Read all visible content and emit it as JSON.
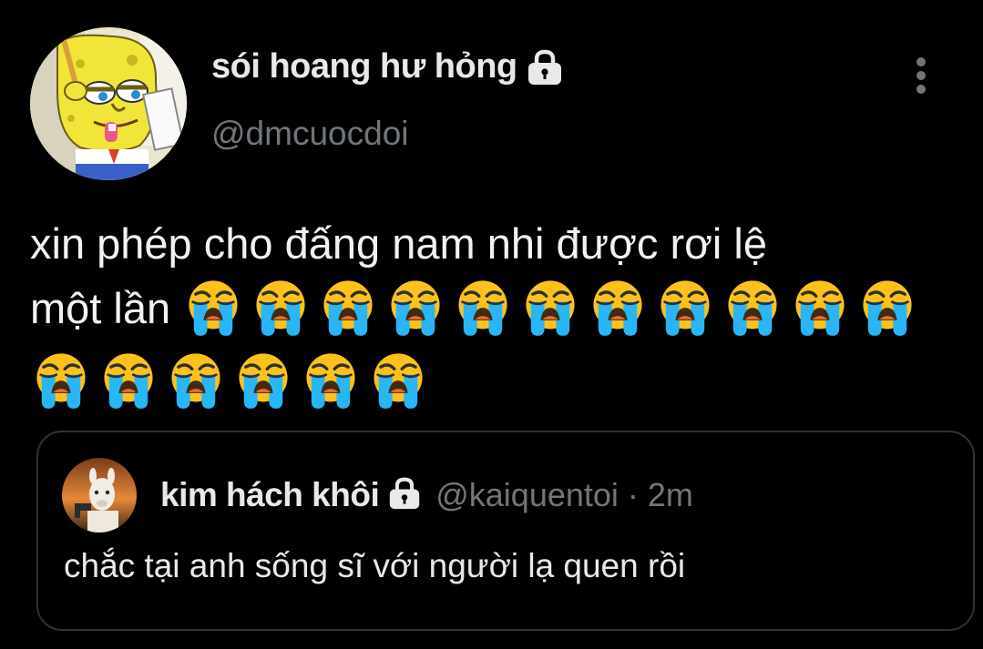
{
  "tweet": {
    "author": {
      "display_name": "sói hoang hư hỏng",
      "handle": "@dmcuocdoi",
      "avatar_icon": "spongebob-avatar",
      "protected_icon": "lock-icon"
    },
    "text": "xin phép cho đấng nam nhi được rơi lệ một lần",
    "text_line1": "xin phép cho đấng nam nhi được rơi lệ",
    "text_line2": "một lần",
    "emoji": "loudly-crying-face",
    "emoji_char": "😭",
    "emoji_count": 17,
    "more_icon": "more-vertical-icon"
  },
  "quoted_tweet": {
    "author": {
      "display_name": "kim hách khôi",
      "handle": "@kaiquentoi",
      "avatar_icon": "llama-avatar",
      "protected_icon": "lock-icon"
    },
    "separator": "·",
    "time": "2m",
    "text": "chắc tại anh sống sĩ với người lạ quen rồi"
  },
  "colors": {
    "background": "#000000",
    "text_primary": "#e7e9ea",
    "text_secondary": "#71767b",
    "border": "#2f3336",
    "emoji_face": "#fcc21b",
    "emoji_tears": "#29b6f6"
  }
}
